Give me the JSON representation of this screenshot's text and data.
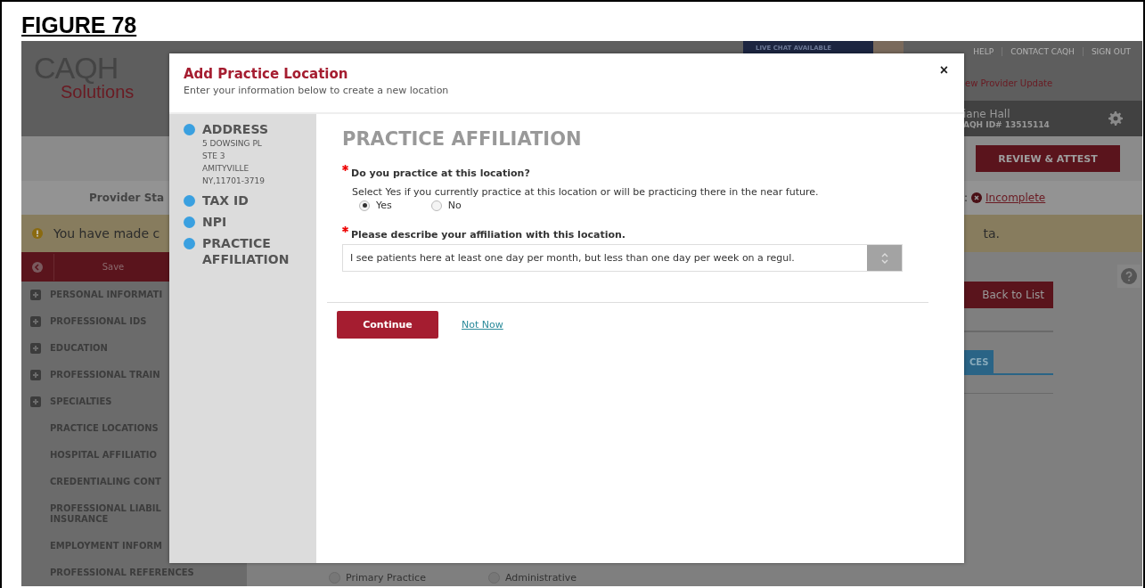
{
  "figure": {
    "title": "FIGURE 78"
  },
  "header": {
    "logo": {
      "wordmark": "CAQH",
      "tagline": "Solutions"
    },
    "live_chat": "LIVE CHAT AVAILABLE",
    "links": [
      "HELP",
      "CONTACT CAQH",
      "SIGN OUT"
    ],
    "update_link": "ew Provider Update",
    "user": {
      "name": "iane Hall",
      "id": "AQH ID# 13515114"
    }
  },
  "toolbar": {
    "review_button": "REVIEW & ATTEST"
  },
  "status_bar": {
    "label": "Provider Sta",
    "separator": ":",
    "status": "Incomplete"
  },
  "warning": {
    "text": "You have made c",
    "text_end": "ta."
  },
  "sidebar": {
    "save_button": "Save",
    "items": [
      {
        "label": "PERSONAL INFORMATI",
        "kind": "group"
      },
      {
        "label": "PROFESSIONAL IDS",
        "kind": "group"
      },
      {
        "label": "EDUCATION",
        "kind": "group"
      },
      {
        "label": "PROFESSIONAL TRAIN",
        "kind": "group"
      },
      {
        "label": "SPECIALTIES",
        "kind": "group"
      },
      {
        "label": "PRACTICE LOCATIONS",
        "kind": "page"
      },
      {
        "label": "HOSPITAL AFFILIATIO",
        "kind": "page"
      },
      {
        "label": "CREDENTIALING CONT",
        "kind": "page"
      },
      {
        "label": "PROFESSIONAL LIABIL INSURANCE",
        "kind": "page"
      },
      {
        "label": "EMPLOYMENT INFORM",
        "kind": "page"
      },
      {
        "label": "PROFESSIONAL REFERENCES",
        "kind": "page"
      }
    ]
  },
  "main": {
    "back_button": "Back to List",
    "tab": {
      "label": "CES",
      "selected": true
    },
    "practice_types": [
      {
        "label": "Primary Practice",
        "selected": false
      },
      {
        "label": "Administrative",
        "selected": false
      }
    ]
  },
  "modal": {
    "title": "Add Practice Location",
    "subtitle": "Enter your information below to create a new location",
    "close": "×",
    "steps": [
      {
        "label": "ADDRESS",
        "details": [
          "5 DOWSING PL",
          "STE 3",
          "AMITYVILLE",
          "NY,11701-3719"
        ]
      },
      {
        "label": "TAX ID"
      },
      {
        "label": "NPI"
      },
      {
        "label": "PRACTICE AFFILIATION"
      }
    ],
    "heading": "PRACTICE AFFILIATION",
    "question_1": {
      "label": "Do you practice at this location?",
      "required": true,
      "help": "Select Yes if you currently practice at this location or will be practicing there in the near future.",
      "options": [
        {
          "label": "Yes",
          "selected": true
        },
        {
          "label": "No",
          "selected": false
        }
      ]
    },
    "question_2": {
      "label": "Please describe your affiliation with this location.",
      "required": true,
      "value": "I see patients here at least one day per month, but less than one day per week on a regul."
    },
    "continue_button": "Continue",
    "not_now_link": "Not Now"
  }
}
